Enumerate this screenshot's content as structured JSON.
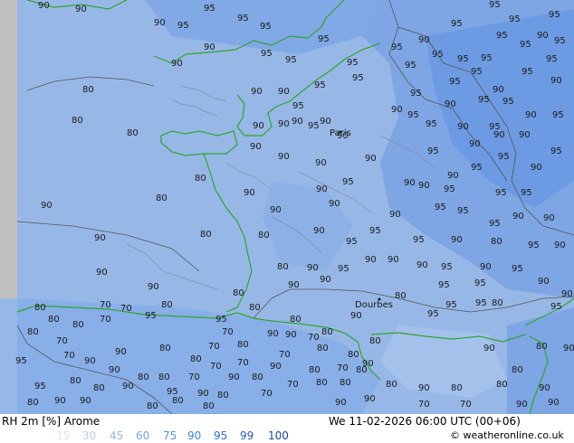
{
  "map": {
    "cities": [
      "Paris",
      "Dourbes"
    ],
    "rh_labels": [
      "90",
      "90",
      "90",
      "95",
      "95",
      "90",
      "95",
      "95",
      "95",
      "95",
      "90",
      "95",
      "95",
      "95",
      "95",
      "90",
      "95",
      "90",
      "95",
      "95",
      "95",
      "95",
      "95",
      "95",
      "95",
      "90",
      "95",
      "95",
      "95",
      "95",
      "95",
      "90",
      "95",
      "95",
      "90",
      "95",
      "95",
      "90",
      "90",
      "95",
      "95",
      "95",
      "95",
      "90",
      "95",
      "95",
      "90",
      "90",
      "90",
      "90",
      "95",
      "95",
      "90",
      "95",
      "95",
      "90",
      "90",
      "95",
      "95",
      "95",
      "80",
      "80",
      "80",
      "90",
      "90",
      "90",
      "90",
      "95",
      "95",
      "90",
      "90",
      "90",
      "90",
      "90",
      "90",
      "80",
      "90",
      "95",
      "90",
      "90",
      "80",
      "90",
      "90",
      "90",
      "90",
      "95",
      "95",
      "95",
      "90",
      "90",
      "90",
      "80",
      "90",
      "95",
      "95",
      "95",
      "90",
      "80",
      "95",
      "90",
      "80",
      "90",
      "90",
      "95",
      "90",
      "90",
      "90",
      "95",
      "80",
      "90",
      "95",
      "95",
      "95",
      "90",
      "90",
      "90",
      "80",
      "90",
      "90",
      "80",
      "80",
      "70",
      "80",
      "90",
      "95",
      "95",
      "95",
      "95",
      "80",
      "80",
      "80",
      "70",
      "80",
      "80",
      "80",
      "70",
      "95",
      "95",
      "70",
      "90",
      "90",
      "70",
      "80",
      "80",
      "90",
      "80",
      "90",
      "70",
      "70",
      "90",
      "80",
      "70",
      "80",
      "70",
      "80",
      "80",
      "90",
      "90",
      "80",
      "70",
      "70",
      "90",
      "80",
      "70",
      "80",
      "80",
      "90",
      "80",
      "80",
      "70",
      "90",
      "80",
      "70",
      "80",
      "80",
      "80",
      "90",
      "80",
      "80",
      "90",
      "80",
      "95",
      "80",
      "95",
      "90",
      "95",
      "90",
      "70",
      "80",
      "80",
      "90",
      "90",
      "80",
      "90",
      "70",
      "70",
      "90",
      "90",
      "80",
      "80",
      "90",
      "90",
      "80",
      "90",
      "90",
      "90",
      "90",
      "90",
      "90",
      "80",
      "80"
    ]
  },
  "footer": {
    "title": "RH 2m [%] Arome",
    "datetime": "We 11-02-2026 06:00 UTC (00+06)",
    "credit": "© weatheronline.co.uk",
    "scale": [
      {
        "label": "15",
        "color": "#dbe6f5"
      },
      {
        "label": "30",
        "color": "#b8cde9"
      },
      {
        "label": "45",
        "color": "#96b6df"
      },
      {
        "label": "60",
        "color": "#6ea7e8"
      },
      {
        "label": "75",
        "color": "#4f94e3"
      },
      {
        "label": "90",
        "color": "#3c82de"
      },
      {
        "label": "95",
        "color": "#2c6fd2"
      },
      {
        "label": "99",
        "color": "#1e5bc2"
      },
      {
        "label": "100",
        "color": "#1747a8"
      }
    ]
  }
}
